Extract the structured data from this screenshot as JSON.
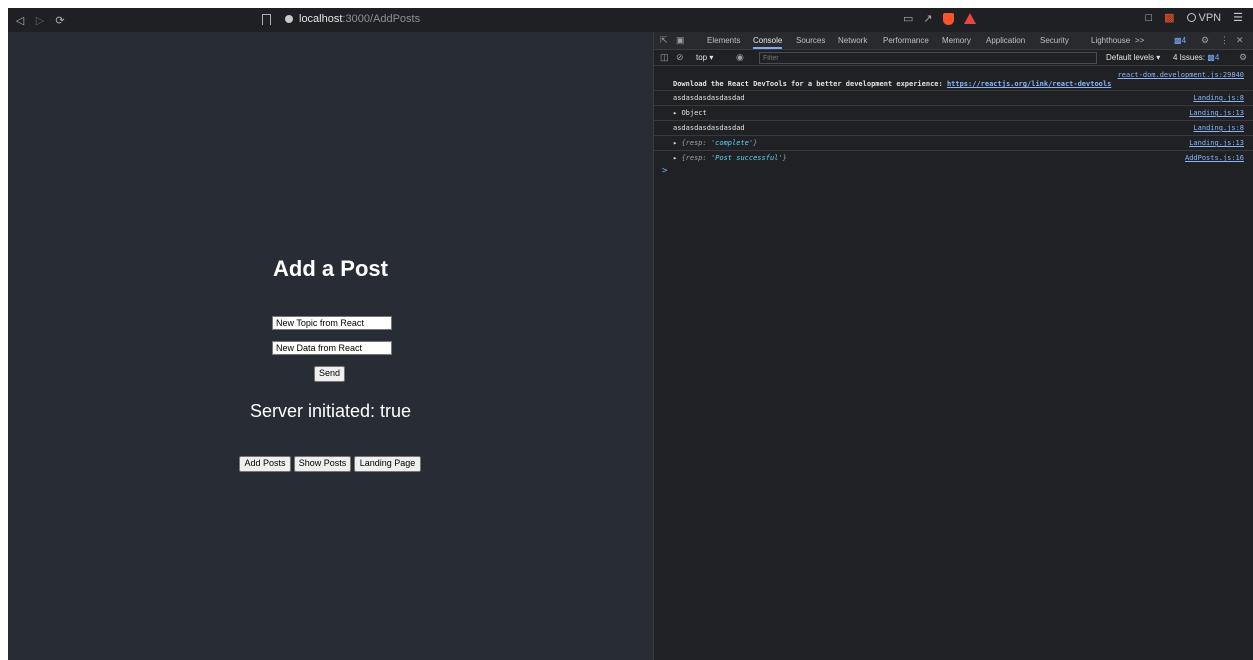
{
  "browser": {
    "back_icon": "back-icon",
    "forward_icon": "forward-icon",
    "reload_icon": "reload-icon",
    "url_host": "localhost",
    "url_path": ":3000/AddPosts",
    "vpn_label": "VPN"
  },
  "page": {
    "background": "#282c34",
    "title": "Add a Post",
    "topic_value": "New Topic from React",
    "data_value": "New Data from React",
    "send_label": "Send",
    "server_status": "Server initiated: true",
    "nav": {
      "add_posts": "Add Posts",
      "show_posts": "Show Posts",
      "landing_page": "Landing Page"
    }
  },
  "devtools": {
    "tabs": [
      "Elements",
      "Console",
      "Sources",
      "Network",
      "Performance",
      "Memory",
      "Application",
      "Security",
      "Lighthouse"
    ],
    "active_tab": "Console",
    "more_tabs": ">>",
    "message_count": "4",
    "context": "top",
    "filter_placeholder": "Filter",
    "default_levels": "Default levels",
    "issues_label": "4 Issues:",
    "issues_count": "4",
    "console": {
      "devtools_msg_prefix": "Download the React DevTools for a better development experience: ",
      "devtools_link": "https://reactjs.org/link/react-devtools",
      "devtools_src": "react-dom.development.js:29840",
      "rows": [
        {
          "msg": "asdasdasdasdasdad",
          "src": "Landing.js:8"
        },
        {
          "msg": "Object",
          "src": "Landing.js:13"
        },
        {
          "msg": "asdasdasdasdasdad",
          "src": "Landing.js:8"
        },
        {
          "key": "resp",
          "value": "'complete'",
          "src": "Landing.js:13"
        },
        {
          "key": "resp",
          "value": "'Post successful'",
          "src": "AddPosts.js:16"
        }
      ],
      "prompt": ">"
    }
  }
}
